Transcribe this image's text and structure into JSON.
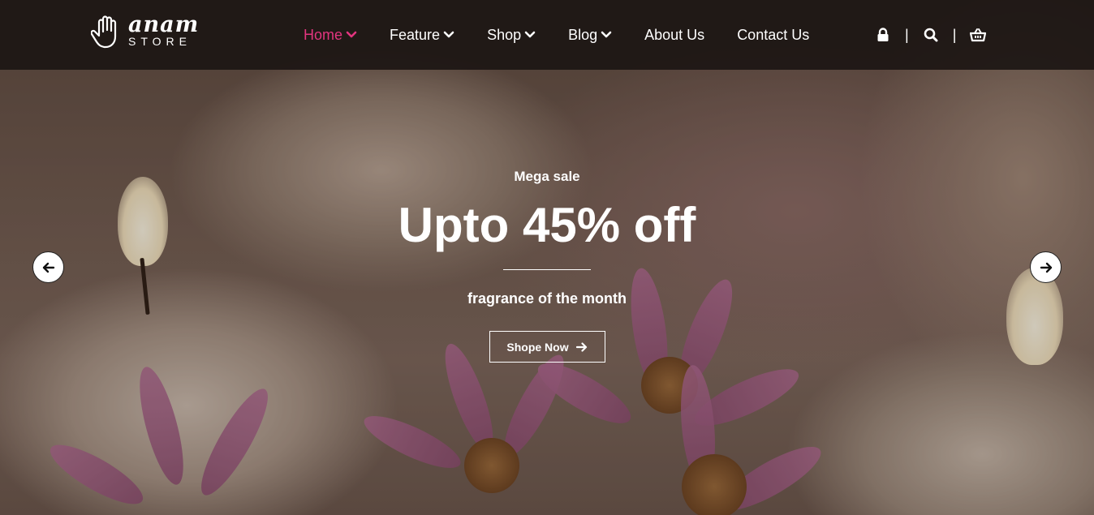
{
  "brand": {
    "name": "anam",
    "sub": "STORE"
  },
  "nav": {
    "items": [
      {
        "label": "Home",
        "dropdown": true,
        "active": true
      },
      {
        "label": "Feature",
        "dropdown": true,
        "active": false
      },
      {
        "label": "Shop",
        "dropdown": true,
        "active": false
      },
      {
        "label": "Blog",
        "dropdown": true,
        "active": false
      },
      {
        "label": "About Us",
        "dropdown": false,
        "active": false
      },
      {
        "label": "Contact Us",
        "dropdown": false,
        "active": false
      }
    ]
  },
  "tools": {
    "separator": "|",
    "icons": [
      "lock-icon",
      "search-icon",
      "basket-icon"
    ]
  },
  "slide": {
    "eyebrow": "Mega sale",
    "headline": "Upto 45% off",
    "tagline": "fragrance of the month",
    "cta": "Shope Now"
  },
  "colors": {
    "accent": "#e2357f",
    "header_bg": "#1c1614",
    "text": "#ffffff"
  }
}
